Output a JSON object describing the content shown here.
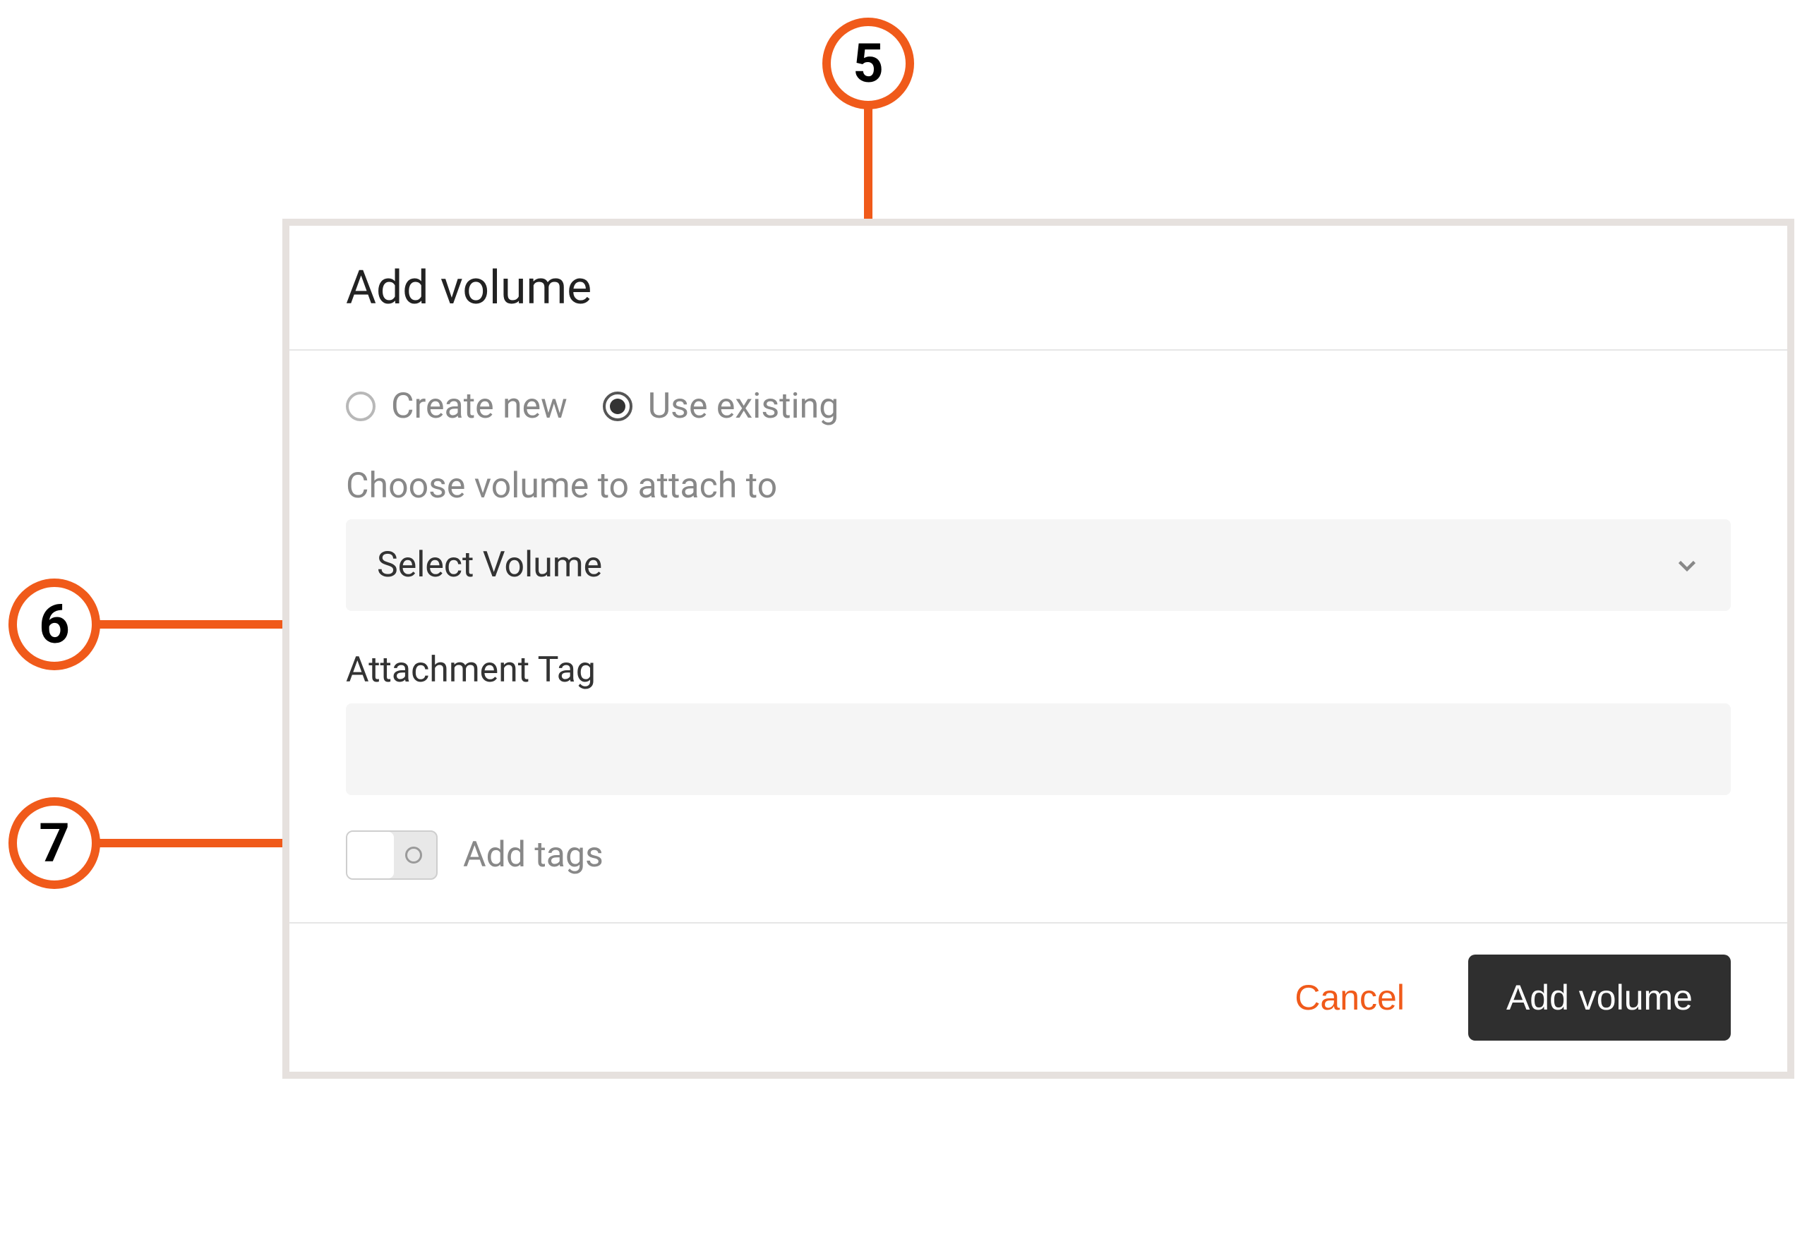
{
  "dialog": {
    "title": "Add volume",
    "radios": {
      "create_new": {
        "label": "Create new",
        "selected": false
      },
      "use_existing": {
        "label": "Use existing",
        "selected": true
      }
    },
    "volume_select": {
      "label": "Choose volume to attach to",
      "value": "Select Volume"
    },
    "attachment_tag": {
      "label": "Attachment Tag",
      "value": ""
    },
    "add_tags_toggle": {
      "label": "Add tags",
      "on": false
    },
    "buttons": {
      "cancel": "Cancel",
      "submit": "Add volume"
    }
  },
  "callouts": {
    "c5": "5",
    "c6": "6",
    "c7": "7"
  },
  "colors": {
    "accent": "#F05A1A",
    "dialog_border": "#E6E1DE",
    "field_bg": "#F5F5F5",
    "primary_btn": "#2F2F2F"
  }
}
